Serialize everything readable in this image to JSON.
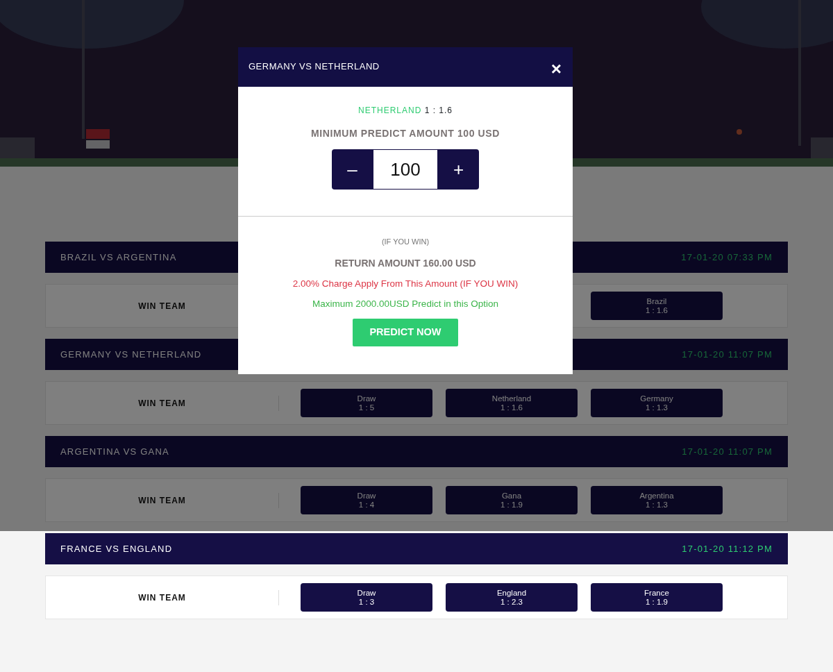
{
  "matches": [
    {
      "title": "BRAZIL VS ARGENTINA",
      "datetime": "17-01-20 07:33 PM",
      "market": "WIN TEAM",
      "options": [
        {
          "team": "Brazil",
          "odds": "1 : 1.6"
        }
      ]
    },
    {
      "title": "GERMANY VS NETHERLAND",
      "datetime": "17-01-20 11:07 PM",
      "market": "WIN TEAM",
      "options": [
        {
          "team": "Draw",
          "odds": "1 : 5"
        },
        {
          "team": "Netherland",
          "odds": "1 : 1.6"
        },
        {
          "team": "Germany",
          "odds": "1 : 1.3"
        }
      ]
    },
    {
      "title": "ARGENTINA VS GANA",
      "datetime": "17-01-20 11:07 PM",
      "market": "WIN TEAM",
      "options": [
        {
          "team": "Draw",
          "odds": "1 : 4"
        },
        {
          "team": "Gana",
          "odds": "1 : 1.9"
        },
        {
          "team": "Argentina",
          "odds": "1 : 1.3"
        }
      ]
    },
    {
      "title": "FRANCE VS ENGLAND",
      "datetime": "17-01-20 11:12 PM",
      "market": "WIN TEAM",
      "options": [
        {
          "team": "Draw",
          "odds": "1 : 3"
        },
        {
          "team": "England",
          "odds": "1 : 2.3"
        },
        {
          "team": "France",
          "odds": "1 : 1.9"
        }
      ]
    }
  ],
  "modal": {
    "title": "GERMANY VS NETHERLAND",
    "close": "×",
    "selection": {
      "team": "NETHERLAND",
      "odds": "1 : 1.6"
    },
    "minimum": "MINIMUM PREDICT AMOUNT 100 USD",
    "stepper": {
      "minus": "–",
      "value": "100",
      "plus": "+"
    },
    "condition": "(IF YOU WIN)",
    "return_amount": "RETURN AMOUNT 160.00 USD",
    "charge_note": "2.00% Charge Apply From This Amount (IF YOU WIN)",
    "max_note": "Maximum 2000.00USD Predict in this Option",
    "submit": "PREDICT NOW"
  }
}
